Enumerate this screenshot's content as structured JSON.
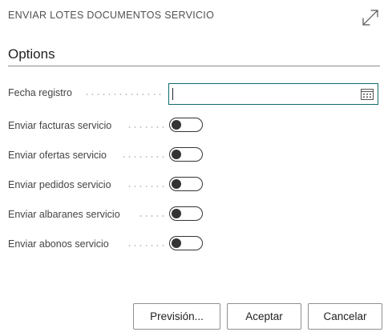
{
  "dialog": {
    "title": "ENVIAR LOTES DOCUMENTOS SERVICIO",
    "expand_icon": "expand-icon"
  },
  "section": {
    "title": "Options"
  },
  "fields": {
    "posting_date": {
      "label": "Fecha registro",
      "value": "",
      "icon": "calendar-icon"
    },
    "toggles": [
      {
        "label": "Enviar facturas servicio",
        "value": false
      },
      {
        "label": "Enviar ofertas servicio",
        "value": false
      },
      {
        "label": "Enviar pedidos servicio",
        "value": false
      },
      {
        "label": "Enviar albaranes servicio",
        "value": false
      },
      {
        "label": "Enviar abonos servicio",
        "value": false
      }
    ]
  },
  "buttons": {
    "preview": "Previsión...",
    "ok": "Aceptar",
    "cancel": "Cancelar"
  },
  "colors": {
    "focus_border": "#0f6b6b",
    "toggle_off": "#333333"
  }
}
